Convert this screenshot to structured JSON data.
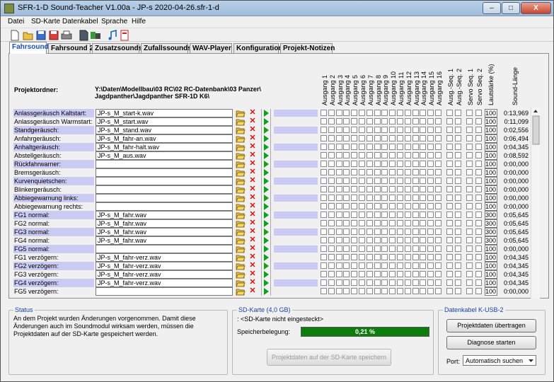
{
  "window": {
    "title": "SFR-1-D Sound-Teacher V1.00a - JP-s 2020-04-26.sfr-1-d",
    "controls": {
      "minimize": "–",
      "maximize": "□",
      "close": "X"
    }
  },
  "menu": [
    "Datei",
    "SD-Karte",
    "Datenkabel",
    "Sprache",
    "Hilfe"
  ],
  "toolbar_icons": [
    "new-file-icon",
    "open-folder-icon",
    "save-icon",
    "save-as-icon",
    "print-icon",
    "sd-card-icon",
    "transfer-icon",
    "music-note-icon",
    "help-book-icon"
  ],
  "tabs": [
    "Fahrsound",
    "Fahrsound 2",
    "Zusatzsounds",
    "Zufallssounds",
    "WAV-Player",
    "Konfiguration",
    "Projekt-Notizen"
  ],
  "project": {
    "label": "Projektordner:",
    "path_line1": "Y:\\Daten\\Modellbau\\03 RC\\02 RC-Datenbank\\03 Panzer\\",
    "path_line2": "Jagdpanther\\Jagdpanther SFR-1D K6\\"
  },
  "column_headers": {
    "outputs": [
      "Ausgang 1",
      "Ausgang 2",
      "Ausgang 3",
      "Ausgang 4",
      "Ausgang 5",
      "Ausgang 6",
      "Ausgang 7",
      "Ausgang 8",
      "Ausgang 9",
      "Ausgang 10",
      "Ausgang 11",
      "Ausgang 12",
      "Ausgang 13",
      "Ausgang 14",
      "Ausgang 15",
      "Ausgang 16"
    ],
    "aux": [
      "Ausg.-Seq. 1",
      "Ausg.-Seq. 2",
      "Servo Seq. 1",
      "Servo Seq. 2"
    ],
    "volume": "Lautstärke (%)",
    "length": "Sound-Länge"
  },
  "rows": [
    {
      "name": "Anlassgeräusch Kaltstart:",
      "file": "JP-s_M_start-k.wav",
      "volume": "100",
      "length": "0:13,969"
    },
    {
      "name": "Anlassgeräusch Warmstart:",
      "file": "JP-s_M_start.wav",
      "volume": "100",
      "length": "0:11,099"
    },
    {
      "name": "Standgeräusch:",
      "file": "JP-s_M_stand.wav",
      "volume": "100",
      "length": "0:02,556"
    },
    {
      "name": "Anfahrgeräusch:",
      "file": "JP-s_M_fahr-an.wav",
      "volume": "100",
      "length": "0:06,494"
    },
    {
      "name": "Anhaltgeräusch:",
      "file": "JP-s_M_fahr-halt.wav",
      "volume": "100",
      "length": "0:04,345"
    },
    {
      "name": "Abstellgeräusch:",
      "file": "JP-s_M_aus.wav",
      "volume": "100",
      "length": "0:08,592"
    },
    {
      "name": "Rückfahrwarner:",
      "file": "",
      "volume": "100",
      "length": "0:00,000"
    },
    {
      "name": "Bremsgeräusch:",
      "file": "",
      "volume": "100",
      "length": "0:00,000"
    },
    {
      "name": "Kurvenquietschen:",
      "file": "",
      "volume": "100",
      "length": "0:00,000"
    },
    {
      "name": "Blinkergeräusch:",
      "file": "",
      "volume": "100",
      "length": "0:00,000"
    },
    {
      "name": "Abbiegewarnung links:",
      "file": "",
      "volume": "100",
      "length": "0:00,000"
    },
    {
      "name": "Abbiegewarnung rechts:",
      "file": "",
      "volume": "100",
      "length": "0:00,000"
    },
    {
      "name": "FG1 normal:",
      "file": "JP-s_M_fahr.wav",
      "volume": "300",
      "length": "0:05,645"
    },
    {
      "name": "FG2 normal:",
      "file": "JP-s_M_fahr.wav",
      "volume": "300",
      "length": "0:05,645"
    },
    {
      "name": "FG3 normal:",
      "file": "JP-s_M_fahr.wav",
      "volume": "300",
      "length": "0:05,645"
    },
    {
      "name": "FG4 normal:",
      "file": "JP-s_M_fahr.wav",
      "volume": "300",
      "length": "0:05,645"
    },
    {
      "name": "FG5 normal:",
      "file": "",
      "volume": "100",
      "length": "0:00,000"
    },
    {
      "name": "FG1 verzögern:",
      "file": "JP-s_M_fahr-verz.wav",
      "volume": "100",
      "length": "0:04,345"
    },
    {
      "name": "FG2 verzögern:",
      "file": "JP-s_M_fahr-verz.wav",
      "volume": "100",
      "length": "0:04,345"
    },
    {
      "name": "FG3 verzögern:",
      "file": "JP-s_M_fahr-verz.wav",
      "volume": "100",
      "length": "0:04,345"
    },
    {
      "name": "FG4 verzögern:",
      "file": "JP-s_M_fahr-verz.wav",
      "volume": "100",
      "length": "0:04,345"
    },
    {
      "name": "FG5 verzögern:",
      "file": "",
      "volume": "100",
      "length": "0:00,000"
    }
  ],
  "status": {
    "title": "Status",
    "text": "An dem Projekt wurden Änderungen vorgenommen. Damit diese Änderungen auch im Soundmodul wirksam werden, müssen die Projektdaten auf der SD-Karte gespeichert werden."
  },
  "sdcard": {
    "title": "SD-Karte (4,0 GB)",
    "line": ": <SD-Karte nicht eingesteckt>",
    "usage_label": "Speicherbelegung:",
    "usage_value": "0,21 %",
    "usage_fraction": 1.0,
    "save_button": "Projektdaten auf der SD-Karte speichern"
  },
  "cable": {
    "title": "Datenkabel K-USB-2",
    "transfer_button": "Projektdaten übertragen",
    "diagnose_button": "Diagnose starten",
    "port_label": "Port:",
    "port_value": "Automatisch suchen"
  },
  "colors": {
    "row_highlight": "#cacaf2",
    "progress": "#0c7c0c",
    "tab_active_text": "#1a4fb8",
    "group_title": "#1a3fa8"
  }
}
